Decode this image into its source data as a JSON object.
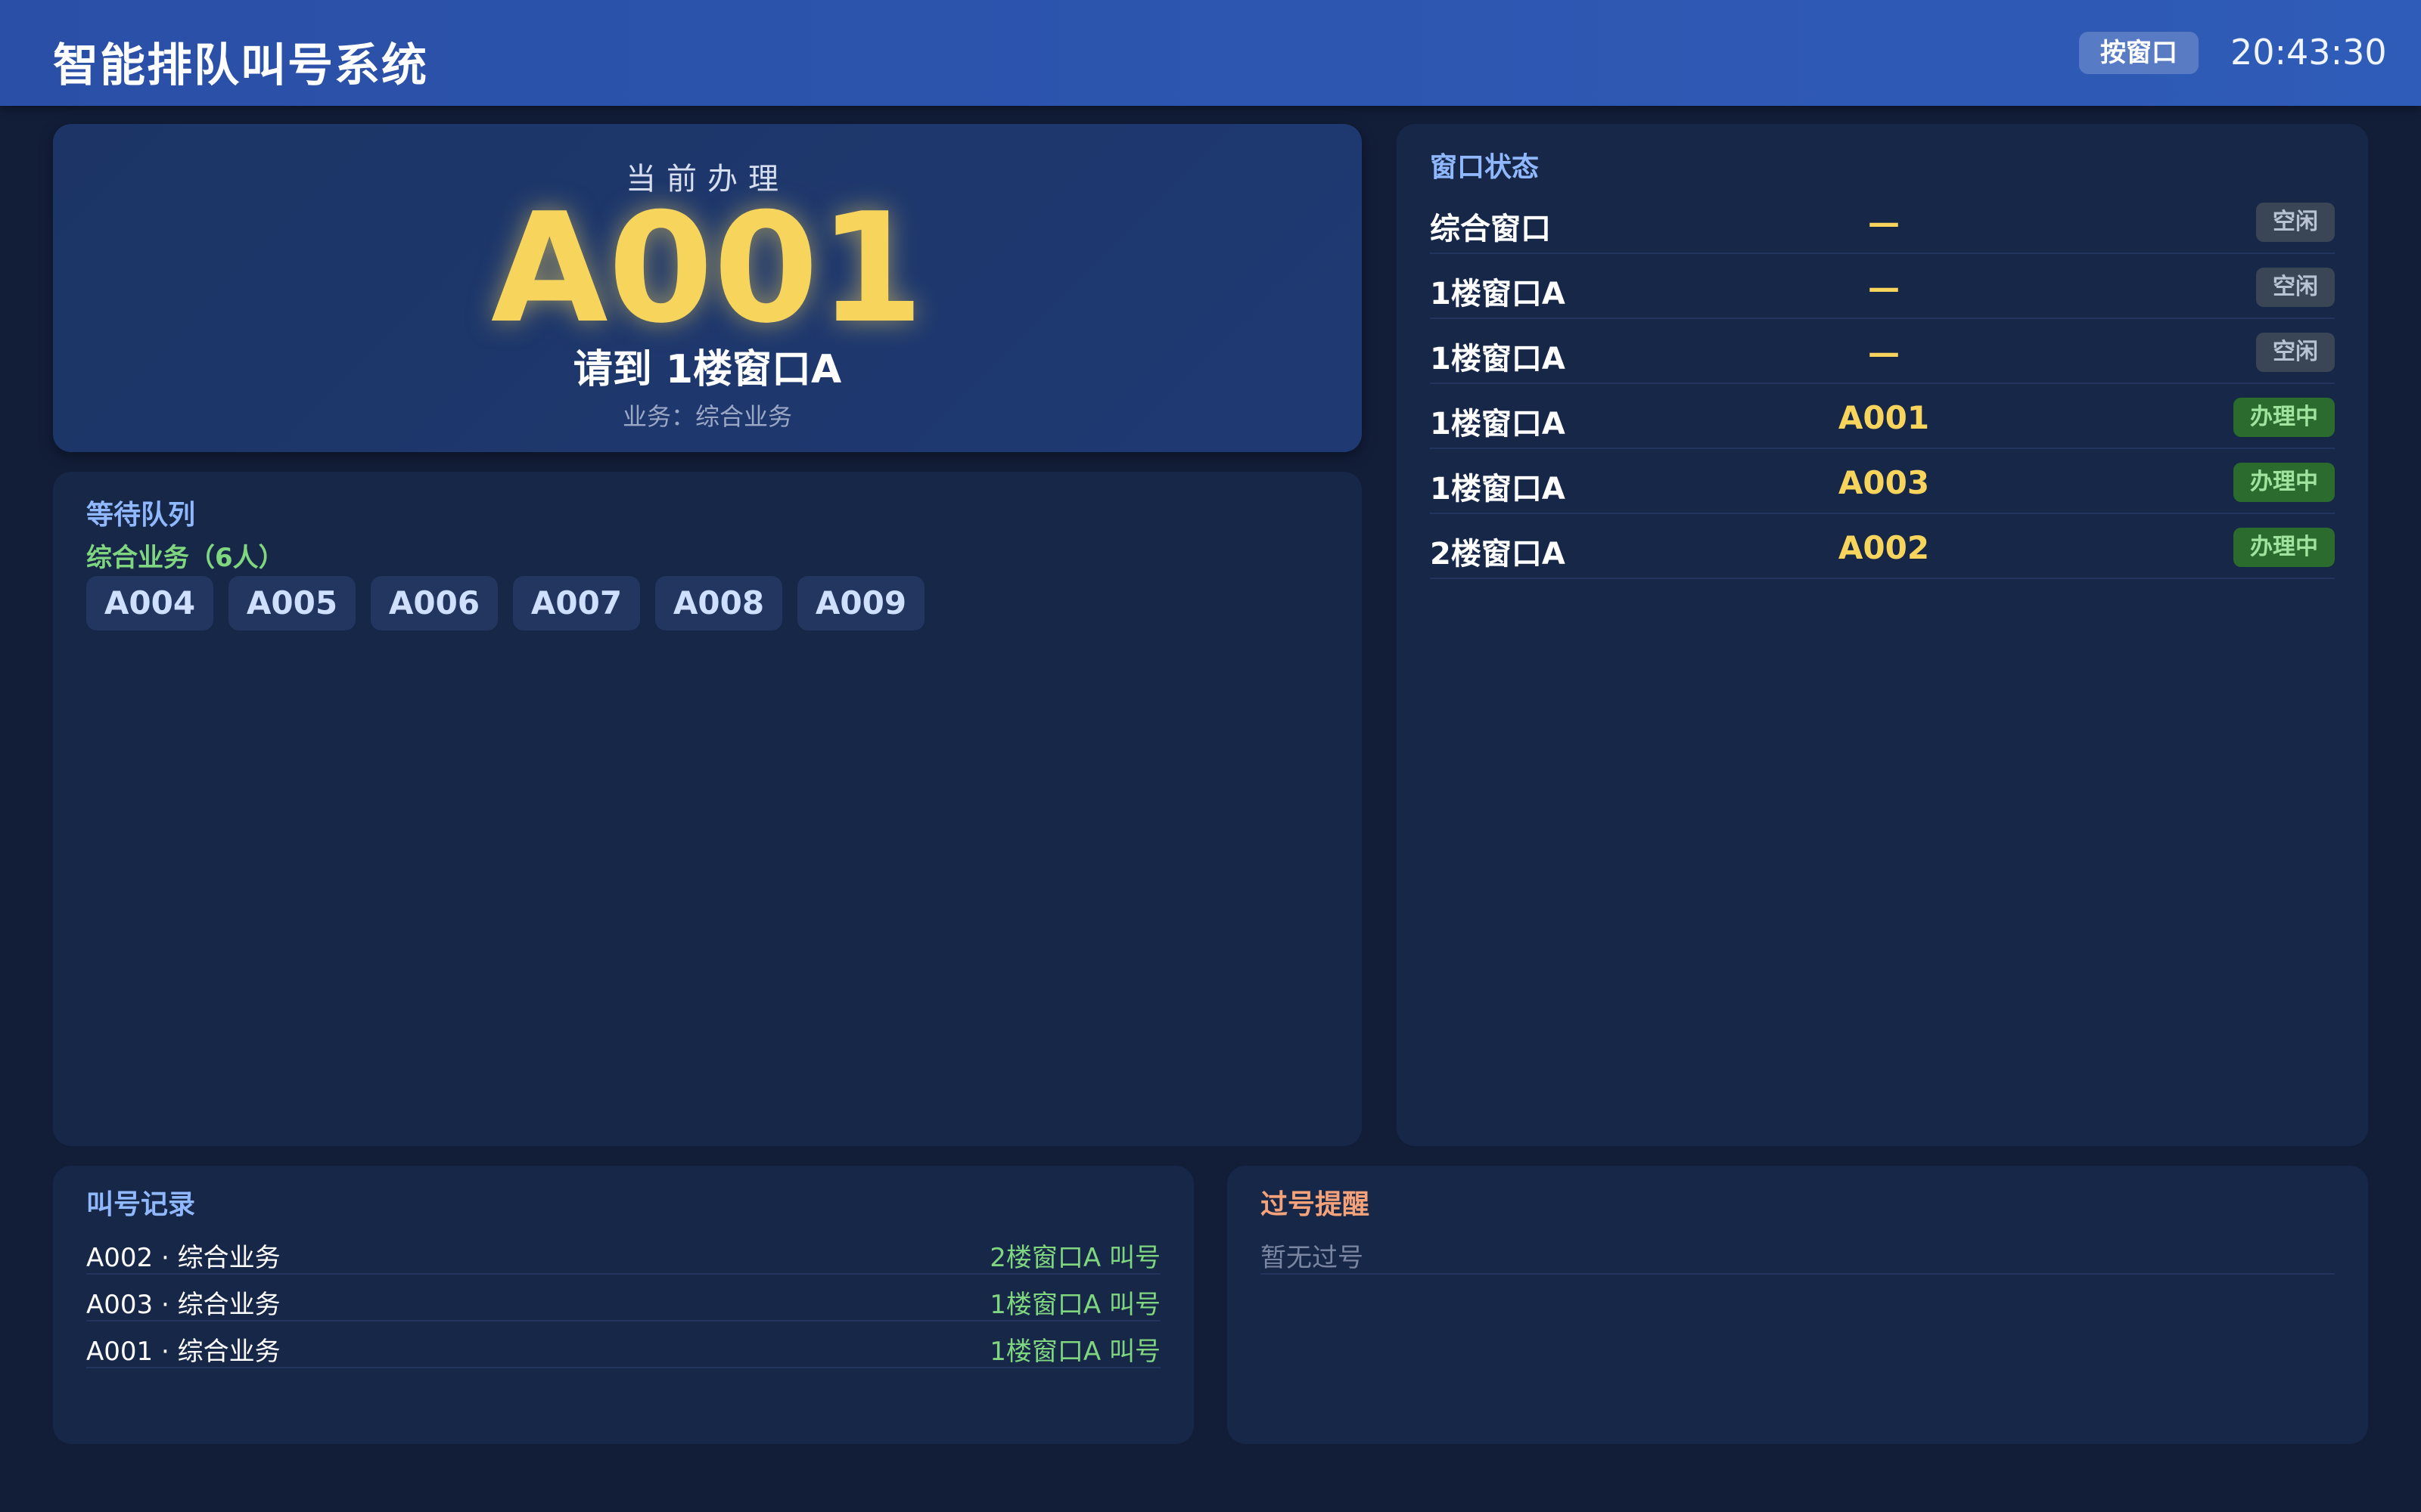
{
  "header": {
    "title": "智能排队叫号系统",
    "mode_button": "按窗口",
    "time": "20:43:30"
  },
  "current": {
    "label": "当前办理",
    "ticket": "A001",
    "window_text": "请到 1楼窗口A",
    "service_text": "业务：综合业务"
  },
  "queue": {
    "title": "等待队列",
    "group_label": "综合业务（6人）",
    "tickets": [
      "A004",
      "A005",
      "A006",
      "A007",
      "A008",
      "A009"
    ]
  },
  "windows": {
    "title": "窗口状态",
    "rows": [
      {
        "name": "综合窗口",
        "ticket": "—",
        "status": "空闲",
        "state": "idle"
      },
      {
        "name": "1楼窗口A",
        "ticket": "—",
        "status": "空闲",
        "state": "idle"
      },
      {
        "name": "1楼窗口A",
        "ticket": "—",
        "status": "空闲",
        "state": "idle"
      },
      {
        "name": "1楼窗口A",
        "ticket": "A001",
        "status": "办理中",
        "state": "busy"
      },
      {
        "name": "1楼窗口A",
        "ticket": "A003",
        "status": "办理中",
        "state": "busy"
      },
      {
        "name": "2楼窗口A",
        "ticket": "A002",
        "status": "办理中",
        "state": "busy"
      }
    ]
  },
  "history": {
    "title": "叫号记录",
    "rows": [
      {
        "ticket": "A002 · 综合业务",
        "window": "2楼窗口A 叫号"
      },
      {
        "ticket": "A003 · 综合业务",
        "window": "1楼窗口A 叫号"
      },
      {
        "ticket": "A001 · 综合业务",
        "window": "1楼窗口A 叫号"
      }
    ]
  },
  "missed": {
    "title": "过号提醒",
    "empty_text": "暂无过号"
  },
  "colors": {
    "background": "#121d38",
    "header": "#2f5cb8",
    "accent_yellow": "#f7d55c",
    "accent_green": "#7fd67f",
    "section_blue": "#8fb8ff",
    "missed_orange": "#f3a27a"
  }
}
